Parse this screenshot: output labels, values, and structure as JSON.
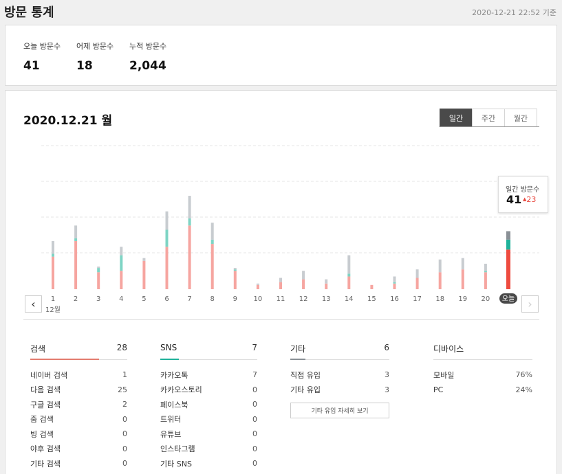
{
  "header": {
    "title": "방문 통계",
    "timestamp": "2020-12-21 22:52 기준"
  },
  "summary": [
    {
      "label": "오늘 방문수",
      "value": "41"
    },
    {
      "label": "어제 방문수",
      "value": "18"
    },
    {
      "label": "누적 방문수",
      "value": "2,044"
    }
  ],
  "main": {
    "date": "2020.12.21 월",
    "tabs": [
      {
        "label": "일간",
        "active": true
      },
      {
        "label": "주간",
        "active": false
      },
      {
        "label": "월간",
        "active": false
      }
    ],
    "prev_icon": "chevron-left-icon",
    "next_icon": "chevron-right-icon",
    "tooltip": {
      "label": "일간 방문수",
      "value": "41",
      "delta": "23",
      "delta_icon": "triangle-up-icon"
    }
  },
  "chart_data": {
    "type": "bar",
    "stacked": true,
    "categories": [
      "1",
      "2",
      "3",
      "4",
      "5",
      "6",
      "7",
      "8",
      "9",
      "10",
      "11",
      "12",
      "13",
      "14",
      "15",
      "16",
      "17",
      "18",
      "19",
      "20",
      "오늘"
    ],
    "month_label": "12월",
    "colors": [
      "#f6a5a0",
      "#7ed4c4",
      "#c8ccd0"
    ],
    "highlight_colors": [
      "#ee4b3f",
      "#1fb29a",
      "#8a9096"
    ],
    "grid": true,
    "series": [
      {
        "values": [
          23,
          34,
          12,
          13,
          20,
          30,
          45,
          32,
          13,
          3,
          5,
          7,
          4,
          9,
          3,
          4,
          8,
          12,
          14,
          12,
          28
        ]
      },
      {
        "values": [
          2,
          2,
          3,
          11,
          0,
          12,
          5,
          3,
          1,
          0,
          0,
          0,
          0,
          2,
          0,
          1,
          0,
          0,
          0,
          1,
          7
        ]
      },
      {
        "values": [
          9,
          9,
          1,
          6,
          2,
          13,
          16,
          12,
          1,
          1,
          3,
          6,
          3,
          13,
          0,
          4,
          6,
          9,
          8,
          5,
          6
        ]
      }
    ]
  },
  "stats": {
    "search": {
      "title": "검색",
      "count": "28",
      "rows": [
        {
          "label": "네이버 검색",
          "value": "1"
        },
        {
          "label": "다음 검색",
          "value": "25"
        },
        {
          "label": "구글 검색",
          "value": "2"
        },
        {
          "label": "줌 검색",
          "value": "0"
        },
        {
          "label": "빙 검색",
          "value": "0"
        },
        {
          "label": "야후 검색",
          "value": "0"
        },
        {
          "label": "기타 검색",
          "value": "0"
        }
      ]
    },
    "sns": {
      "title": "SNS",
      "count": "7",
      "rows": [
        {
          "label": "카카오톡",
          "value": "7"
        },
        {
          "label": "카카오스토리",
          "value": "0"
        },
        {
          "label": "페이스북",
          "value": "0"
        },
        {
          "label": "트위터",
          "value": "0"
        },
        {
          "label": "유튜브",
          "value": "0"
        },
        {
          "label": "인스타그램",
          "value": "0"
        },
        {
          "label": "기타 SNS",
          "value": "0"
        }
      ]
    },
    "etc": {
      "title": "기타",
      "count": "6",
      "rows": [
        {
          "label": "직접 유입",
          "value": "3"
        },
        {
          "label": "기타 유입",
          "value": "3"
        }
      ],
      "button": "기타 유입 자세히 보기"
    },
    "device": {
      "title": "디바이스",
      "rows": [
        {
          "label": "모바일",
          "value": "76%"
        },
        {
          "label": "PC",
          "value": "24%"
        }
      ]
    }
  }
}
